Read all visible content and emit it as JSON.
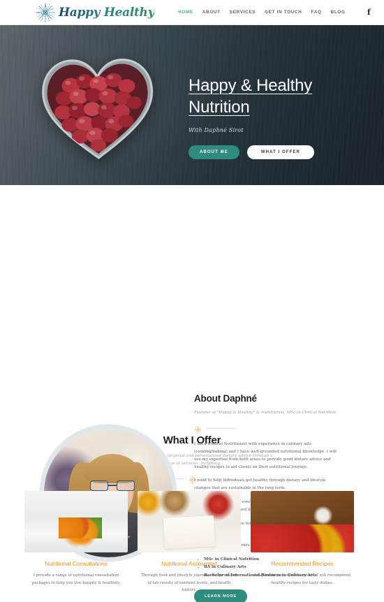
{
  "header": {
    "logo_text": "Happy Healthy",
    "logo_icon": "starburst-mandala-icon",
    "nav": [
      {
        "label": "HOME",
        "active": true
      },
      {
        "label": "ABOUT",
        "active": false
      },
      {
        "label": "SERVICES",
        "active": false
      },
      {
        "label": "GET IN TOUCH",
        "active": false
      },
      {
        "label": "FAQ",
        "active": false
      },
      {
        "label": "BLOG",
        "active": false
      }
    ],
    "facebook_icon": "facebook-icon",
    "facebook_glyph": "f"
  },
  "hero": {
    "title": "Happy & Healthy Nutrition",
    "subtitle": "With Daphné Sirot",
    "primary_button": "ABOUT ME",
    "secondary_button": "WHAT I OFFER",
    "image_alt": "heart-shaped-dish-of-pomegranate-seeds"
  },
  "about": {
    "portrait_alt": "portrait-of-daphne",
    "title": "About Daphné",
    "subtitle": "Founder of \"Happy & Healthy\" & Nutritionist, MSc in Clinical Nutrition",
    "divider_icon": "sun-icon",
    "paragraphs": [
      "I am a Clinical Nutritionist with experience in culinary arts (cooking/baking) and I have well-grounded nutritional knowledge. I will use my expertise from both areas to provide good dietary advice and healthy recipes to aid clients on their nutritional journey.",
      "I want to help individuals get healthy through dietary and lifestyle changes that are sustainable in the long term.",
      "I also want to empower everyone who comes for my services or to my practice to make informed decisions about their nutritional health.",
      "I can communicate in the following languages: English, French and Spanish.",
      "I hold the following degrees in the field of food and nutrition:"
    ],
    "degrees": [
      "MSc in Clinical Nutrition",
      "BA in Culinary Arts",
      "Bachelor of International Business in Culinary Arts"
    ],
    "learn_more_button": "LEARN MORE"
  },
  "offer": {
    "title": "What I Offer",
    "subtitle": "Happy & Healthy provides targeted and personalised dietary advice through a range of services, including:",
    "divider_icon": "sun-icon",
    "cards": [
      {
        "image_alt": "nutritionist-with-fruit-and-measuring-tape",
        "title": "Nutritional Consultations",
        "desc": "I provide a range of nutritional consultation packages to help you live happily & healthily."
      },
      {
        "image_alt": "weekly-meal-plan-sheet-with-food-containers",
        "title": "Nutritional Assesment",
        "desc": "Through food and lifestyle journal, interpretation of lab results of nutrient levels, and health history."
      },
      {
        "image_alt": "spaghetti-tomatoes-peppers-and-basil-on-wood",
        "title": "Recommended Recipes",
        "desc": "Adapted to your specific needs, I will recommend healthy recipes for tasty dishes."
      }
    ]
  },
  "colors": {
    "accent_teal": "#2e8b7f",
    "nav_active": "#49a89b",
    "card_title_orange": "#e8941f",
    "hero_dark": "#223038",
    "sun_icon": "#e8a13a"
  }
}
